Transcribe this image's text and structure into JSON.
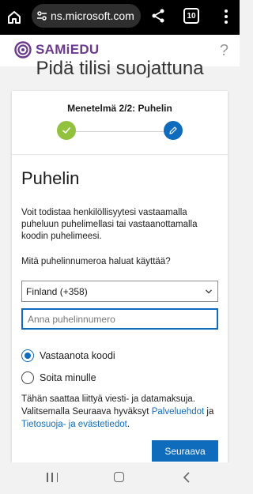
{
  "browser": {
    "url": "ns.microsoft.com",
    "tab_count": "10"
  },
  "header": {
    "brand": "SAMiEDU",
    "help": "?"
  },
  "page": {
    "title": "Pidä tilisi suojattuna"
  },
  "steps": {
    "title": "Menetelmä 2/2: Puhelin"
  },
  "content": {
    "section_title": "Puhelin",
    "description": "Voit todistaa henkilöllisyytesi vastaamalla puheluun puhelimellasi tai vastaanottamalla koodin puhelimeesi.",
    "question": "Mitä puhelinnumeroa haluat käyttää?",
    "country_selected": "Finland (+358)",
    "phone_placeholder": "Anna puhelinnumero",
    "phone_value": "",
    "options": [
      {
        "label": "Vastaanota koodi",
        "checked": true
      },
      {
        "label": "Soita minulle",
        "checked": false
      }
    ],
    "disclaimer_prefix": "Tähän saattaa liittyä viesti- ja datamaksuja. Valitsemalla Seuraava hyväksyt ",
    "terms_link": "Palveluehdot",
    "disclaimer_and": " ja ",
    "privacy_link": "Tietosuoja- ja evästetiedot",
    "disclaimer_suffix": ".",
    "next_button": "Seuraava"
  },
  "colors": {
    "brand": "#6b3a8e",
    "accent": "#0f6cbd",
    "step_done": "#92c13d"
  },
  "icons": {
    "home": "home-icon",
    "site_settings": "tune-icon",
    "share": "share-icon",
    "menu": "more-vert-icon",
    "step_done": "check-icon",
    "step_active": "pencil-icon",
    "select": "chevron-down-icon"
  }
}
